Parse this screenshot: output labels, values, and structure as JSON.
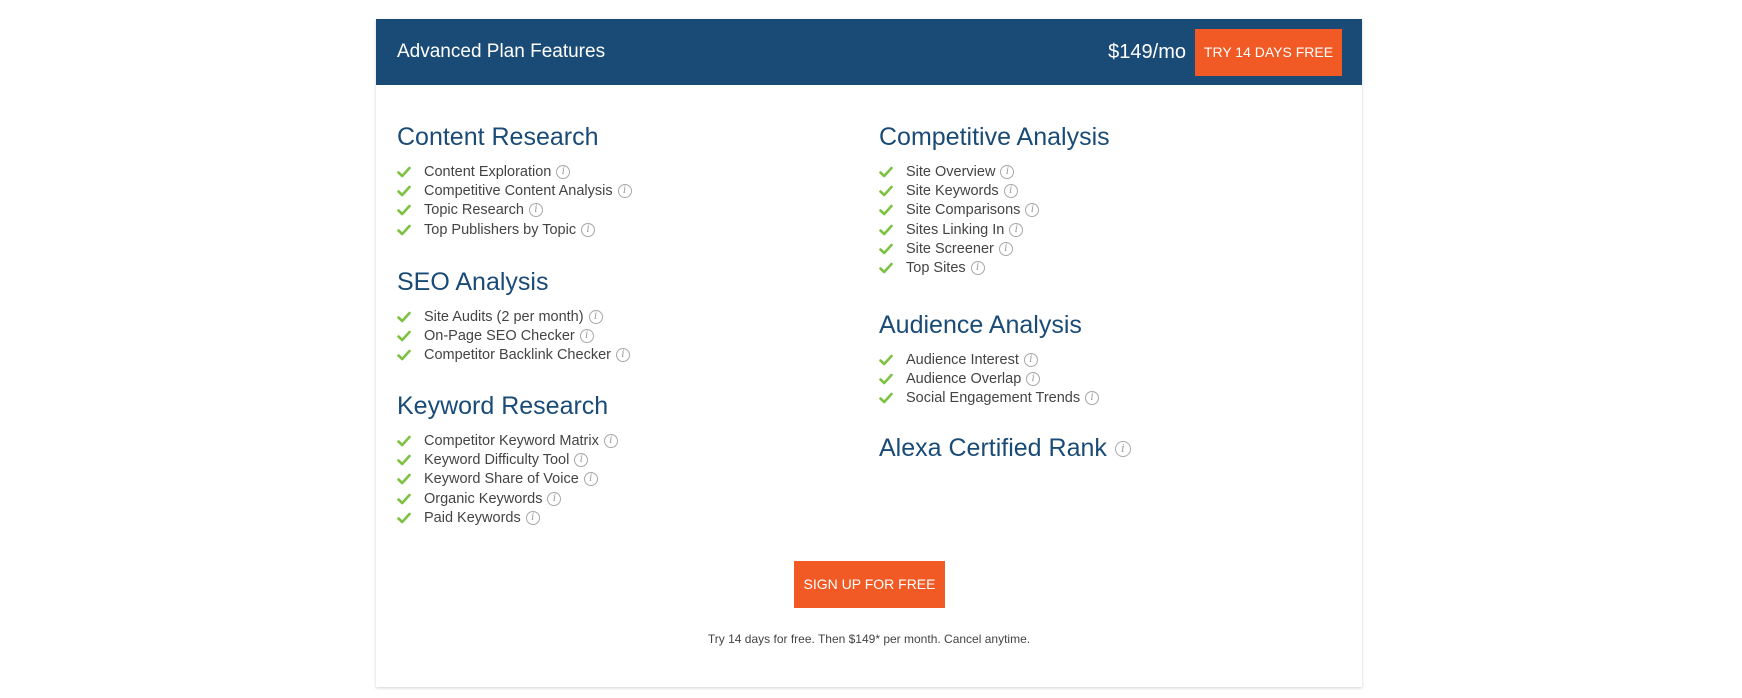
{
  "header": {
    "title": "Advanced Plan Features",
    "price": "$149/mo",
    "cta_label": "TRY 14 DAYS FREE"
  },
  "left_sections": [
    {
      "title": "Content Research",
      "features": [
        "Content Exploration",
        "Competitive Content Analysis",
        "Topic Research",
        "Top Publishers by Topic"
      ]
    },
    {
      "title": "SEO Analysis",
      "features": [
        "Site Audits (2 per month)",
        "On-Page SEO Checker",
        "Competitor Backlink Checker"
      ]
    },
    {
      "title": "Keyword Research",
      "features": [
        "Competitor Keyword Matrix",
        "Keyword Difficulty Tool",
        "Keyword Share of Voice",
        "Organic Keywords",
        "Paid Keywords"
      ]
    }
  ],
  "right_sections": [
    {
      "title": "Competitive Analysis",
      "features": [
        "Site Overview",
        "Site Keywords",
        "Site Comparisons",
        "Sites Linking In",
        "Site Screener",
        "Top Sites"
      ]
    },
    {
      "title": "Audience Analysis",
      "features": [
        "Audience Interest",
        "Audience Overlap",
        "Social Engagement Trends"
      ]
    },
    {
      "title": "Alexa Certified Rank",
      "features": []
    }
  ],
  "signup_label": "SIGN UP FOR FREE",
  "fineprint": "Try 14 days for free. Then $149* per month. Cancel anytime.",
  "icons": {
    "check": "check-icon",
    "info": "info-icon",
    "info_glyph": "i"
  },
  "colors": {
    "header_bg": "#1a4b76",
    "accent": "#f15a24",
    "check": "#7dc242",
    "heading": "#1a4b76",
    "text": "#444444"
  }
}
